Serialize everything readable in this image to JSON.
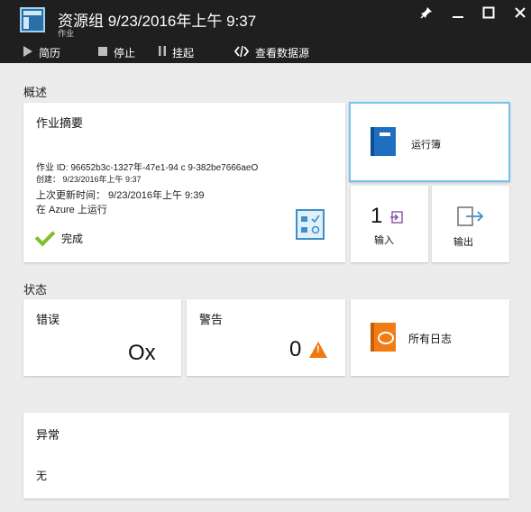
{
  "header": {
    "title": "资源组 9/23/2016年上午 9:37",
    "subtitle": "作业",
    "window_controls": [
      "pin-icon",
      "minimize-icon",
      "maximize-icon",
      "close-icon"
    ]
  },
  "commands": [
    {
      "label": "简历",
      "icon": "play-icon"
    },
    {
      "label": "停止",
      "icon": "stop-icon"
    },
    {
      "label": "挂起",
      "icon": "pause-icon"
    },
    {
      "label": "查看数据源",
      "icon": "code-icon"
    }
  ],
  "overview": {
    "section_label": "概述",
    "job_summary": {
      "title": "作业摘要",
      "job_id": "作业 ID: 96652b3c-1327年-47e1-94 c 9-382be7666aeO",
      "created": "创建： 9/23/2016年上午 9:37",
      "last_updated": "上次更新时间： 9/23/2016年上午 9:39",
      "ran_on": "在 Azure 上运行",
      "status": "完成"
    },
    "runbook_label": "运行簿",
    "input": {
      "count": "1",
      "label": "输入"
    },
    "output": {
      "label": "输出"
    }
  },
  "status": {
    "section_label": "状态",
    "errors": {
      "label": "错误",
      "value": "Ox"
    },
    "warnings": {
      "label": "警告",
      "value": "0"
    },
    "all_logs_label": "所有日志"
  },
  "exceptions": {
    "title": "异常",
    "value": "无"
  },
  "colors": {
    "header_bg": "#1f1f1f",
    "page_bg": "#ececec",
    "accent_blue": "#1e6fbf",
    "selected_border": "#77c2ee",
    "success_green": "#7cbf26",
    "warning_orange": "#f0780e"
  }
}
